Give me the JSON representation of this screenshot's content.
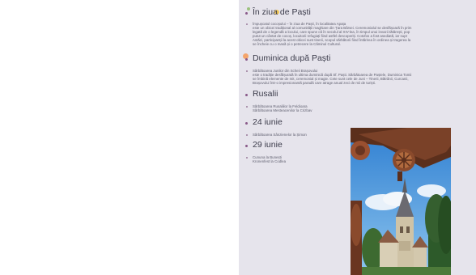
{
  "slide": {
    "sections": [
      {
        "heading": "În ziua de Paști",
        "lines": [
          "Împușcatul cocoșului – în ziua de Paști, în localitatea Apața",
          "este un obicei tradițional al comunității maghiare din Țara Bârsei. Ceremonialul se desfășoară în prim",
          "legată de o legendă a locului, care spune că în secolul al XIV-lea, în timpul unui invazii tătărești, pop",
          "putut un cântat de cocoș, locuitorii refugiați fiind astfel descoperiți. Cotofos a fost asediată, iar supr",
          "Astăzi, participanții la acest obicei sunt tinerii, scopul sărbătorii fiind întărirea în ordinea și tragerea la",
          "se încheie cu o masă și o petrecere la Căminul Cultural."
        ]
      },
      {
        "heading": "Duminica după Paști",
        "lines": [
          "Sărbătoarea Junilor din Scheii Brașovului",
          "este o tradiție desfășurată în ultima duminică după Sf. Paști. Sărbătoarea de Paștele, Duminica Tomii",
          "se îmbină elemente de mit, ceremonial și magie. Cete sunt cele de Juni – Tinerii, Bătrânii, Curcanii,",
          "Brașovului într-o impresionantă paradă care atrage anual zeci de mii de turiști."
        ]
      },
      {
        "heading": "Rusalii",
        "lines": [
          "Sărbătoarea Rusaliilor la Feldioara",
          "Sărbătoarea Mesteacenilor la Crizbav"
        ]
      },
      {
        "heading": "24 iunie",
        "lines": [
          "Sărbătoarea Sânzienelor la Șimon"
        ]
      },
      {
        "heading": "29 iunie",
        "lines": [
          "Cununa la Bunești",
          "Kronenfest la Codlea"
        ]
      }
    ],
    "photo_icon": "church-with-carved-wooden-gate-photo"
  }
}
